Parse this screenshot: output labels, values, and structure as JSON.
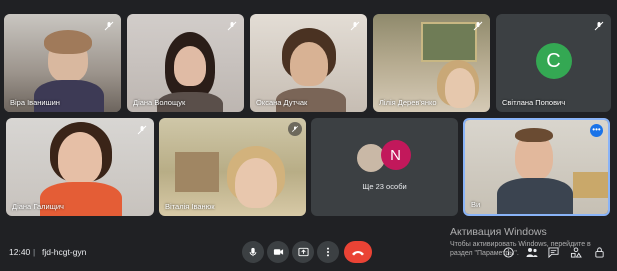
{
  "participants_row1": [
    {
      "name": "Віра Іванишин"
    },
    {
      "name": "Діана Волощук"
    },
    {
      "name": "Оксана Дутчак"
    },
    {
      "name": "Лілія Дерев'янко"
    },
    {
      "name": "Світлана Попович",
      "initial": "C"
    }
  ],
  "participants_row2": [
    {
      "name": "Діана Галищич"
    },
    {
      "name": "Віталія Іванюк"
    }
  ],
  "others_tile": {
    "initial": "N",
    "label": "Ще 23 особи"
  },
  "pinned_tile": {
    "name": "Ви",
    "more": "•••"
  },
  "bottom_bar": {
    "time": "12:40",
    "separator": "|",
    "meeting_code": "fjd-hcgt-gyn"
  },
  "activation": {
    "title": "Активация Windows",
    "text": "Чтобы активировать Windows, перейдите в раздел \"Параметры\"."
  },
  "colors": {
    "background": "#202124",
    "tile": "#3c4043",
    "accent": "#8ab4f8",
    "end_call": "#ea4335",
    "avatar_green": "#34a853",
    "avatar_pink": "#c2185b"
  }
}
